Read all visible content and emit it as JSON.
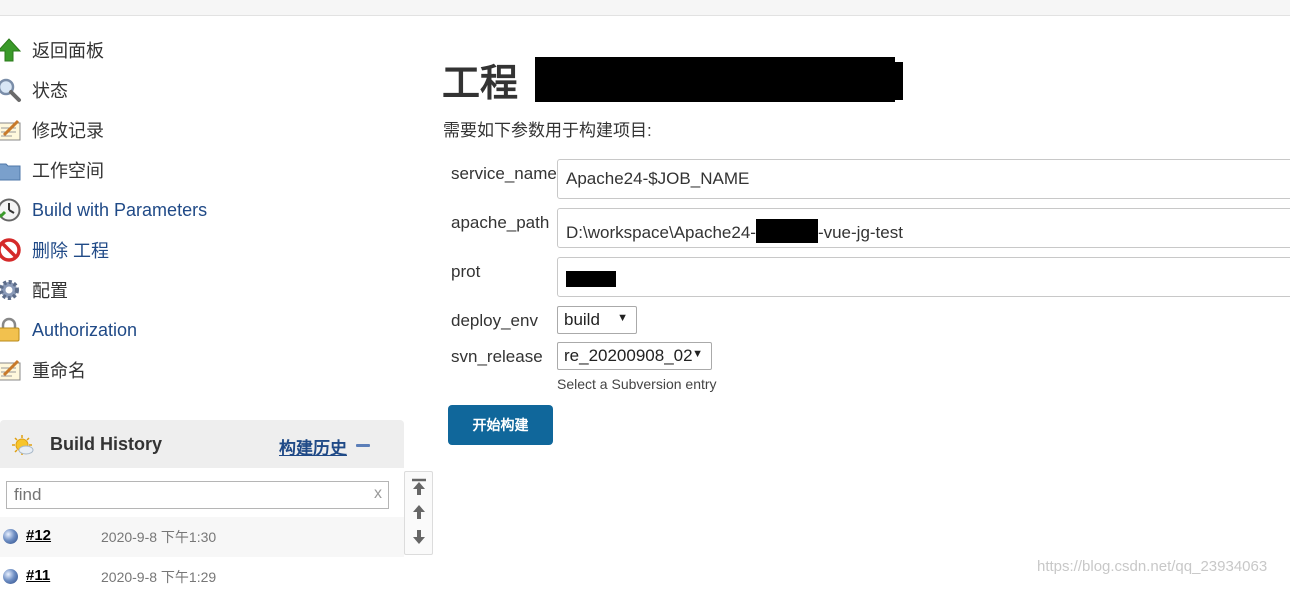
{
  "sidebar": {
    "items": [
      {
        "label": "返回面板",
        "icon": "up-arrow-icon"
      },
      {
        "label": "状态",
        "icon": "search-icon"
      },
      {
        "label": "修改记录",
        "icon": "notepad-icon"
      },
      {
        "label": "工作空间",
        "icon": "folder-icon"
      },
      {
        "label": "Build with Parameters",
        "icon": "clock-icon"
      },
      {
        "label": "删除 工程",
        "icon": "no-entry-icon"
      },
      {
        "label": "配置",
        "icon": "gear-icon"
      },
      {
        "label": "Authorization",
        "icon": "lock-icon"
      },
      {
        "label": "重命名",
        "icon": "notepad-icon"
      }
    ]
  },
  "history": {
    "title": "Build History",
    "title_cn": "构建历史",
    "search_placeholder": "find",
    "clear_label": "x",
    "builds": [
      {
        "number": "#12",
        "time": "2020-9-8 下午1:30"
      },
      {
        "number": "#11",
        "time": "2020-9-8 下午1:29"
      }
    ]
  },
  "main": {
    "title_prefix": "工程",
    "subtitle": "需要如下参数用于构建项目:",
    "params": [
      {
        "name": "service_name",
        "value": "Apache24-$JOB_NAME"
      },
      {
        "name": "apache_path",
        "value_prefix": "D:\\workspace\\Apache24-",
        "value_suffix": "-vue-jg-test"
      },
      {
        "name": "prot",
        "value": ""
      }
    ],
    "deploy_env": {
      "name": "deploy_env",
      "selected": "build"
    },
    "svn_release": {
      "name": "svn_release",
      "selected": "re_20200908_02",
      "help": "Select a Subversion entry"
    },
    "build_button": "开始构建"
  },
  "watermark": "https://blog.csdn.net/qq_23934063",
  "colors": {
    "link": "#204a87",
    "button": "#10679b"
  }
}
